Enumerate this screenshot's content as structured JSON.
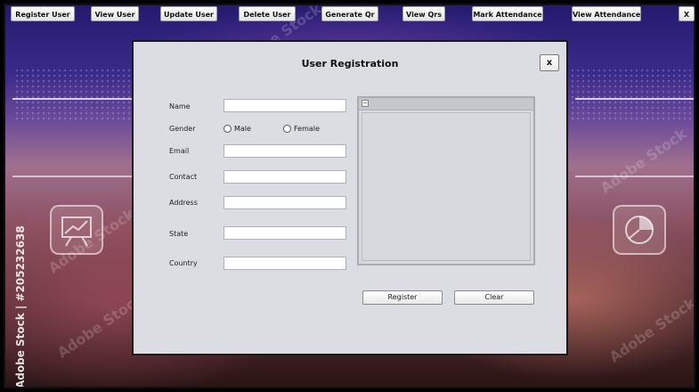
{
  "toolbar": {
    "register_user": "Register User",
    "view_user": "View User",
    "update_user": "Update User",
    "delete_user": "Delete User",
    "generate_qr": "Generate Qr",
    "view_qrs": "View Qrs",
    "mark_attendance": "Mark Attendance",
    "view_attendance": "View Attendance",
    "close": "X"
  },
  "background": {
    "watermark_vertical": "Adobe Stock | #205232638",
    "watermark_diag": "Adobe Stock"
  },
  "dialog": {
    "title": "User Registration",
    "close": "x",
    "labels": {
      "name": "Name",
      "gender": "Gender",
      "email": "Email",
      "contact": "Contact",
      "address": "Address",
      "state": "State",
      "country": "Country"
    },
    "gender_options": {
      "male": "Male",
      "female": "Female"
    },
    "values": {
      "name": "",
      "email": "",
      "contact": "",
      "address": "",
      "state": "",
      "country": ""
    },
    "photo_minimize": "−",
    "register": "Register",
    "clear": "Clear"
  }
}
